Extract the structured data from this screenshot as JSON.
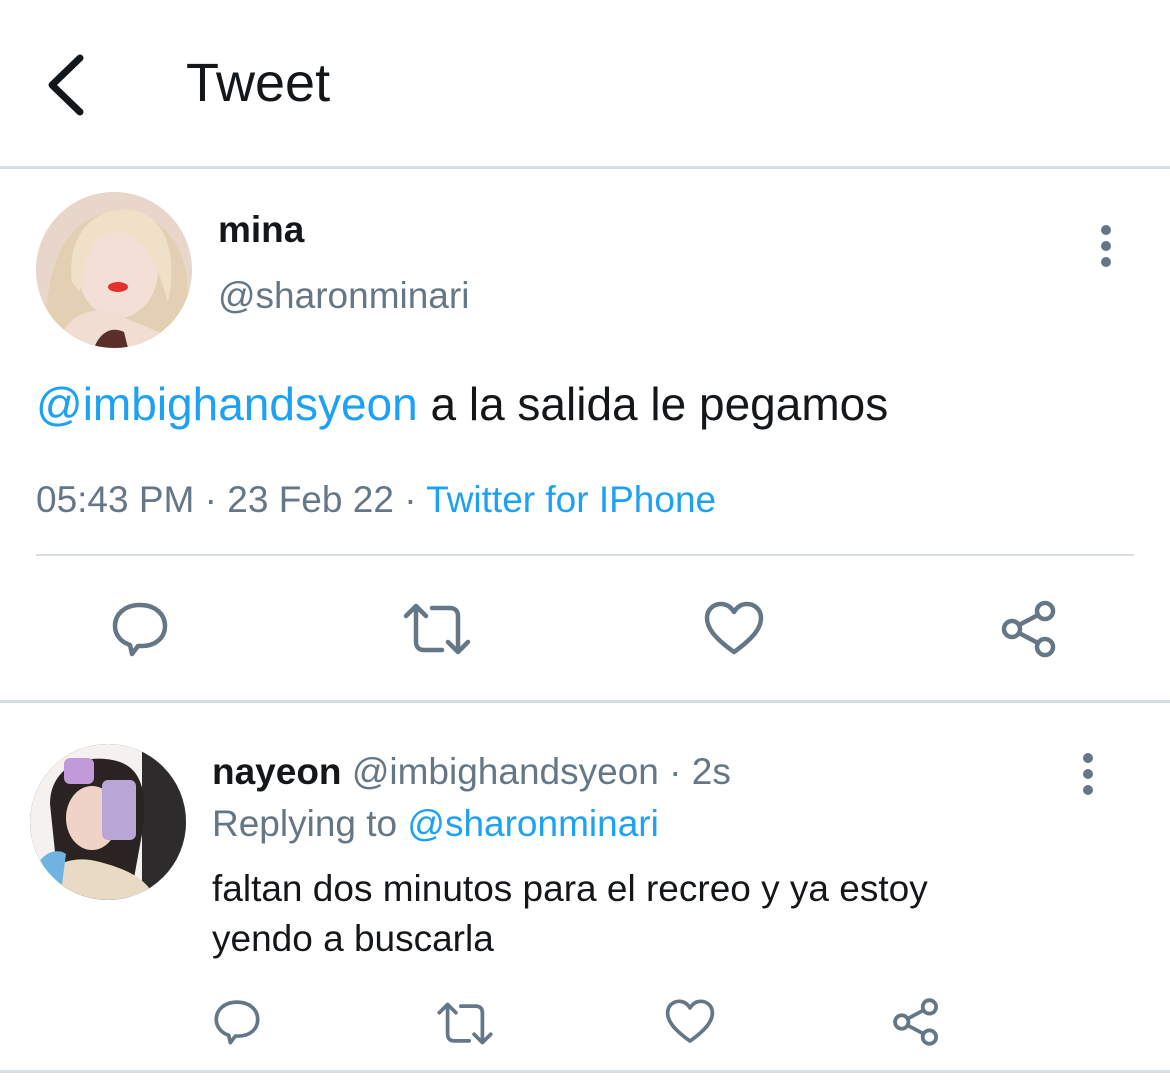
{
  "header": {
    "title": "Tweet"
  },
  "main_tweet": {
    "author_name": "mina",
    "author_handle": "@sharonminari",
    "mention": "@imbighandsyeon",
    "text": " a la salida le pegamos",
    "time": "05:43 PM",
    "date": "23 Feb 22",
    "separator": "·",
    "source": "Twitter for IPhone"
  },
  "reply": {
    "author_name": "nayeon",
    "author_handle": "@imbighandsyeon",
    "age": "· 2s",
    "replying_label": "Replying to",
    "replying_handle": "@sharonminari",
    "text_line1": "faltan dos minutos para el recreo y ya estoy",
    "text_line2": "yendo a buscarla"
  },
  "icons": {
    "back": "chevron-left-icon",
    "more": "more-vertical-icon",
    "reply": "comment-icon",
    "retweet": "retweet-icon",
    "like": "heart-icon",
    "share": "share-icon"
  },
  "colors": {
    "accent": "#1da1f2",
    "secondary_text": "#657786",
    "icon": "#657786",
    "divider": "#d8dde1"
  }
}
